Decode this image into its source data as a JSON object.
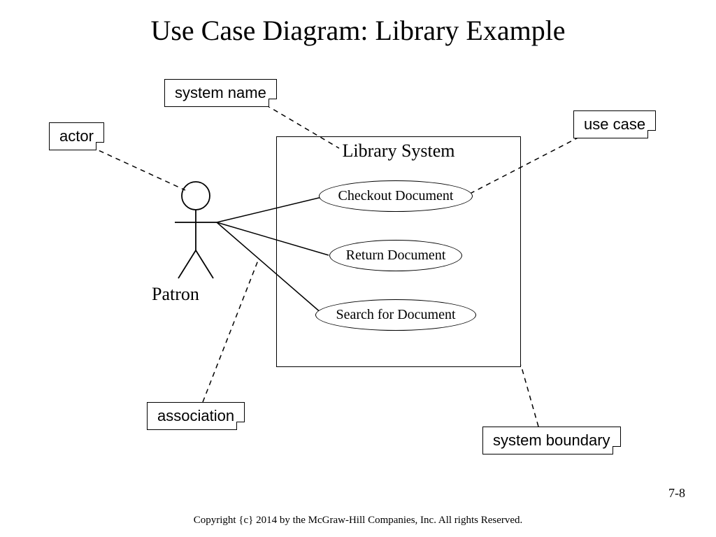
{
  "title": "Use Case Diagram: Library Example",
  "notes": {
    "actor": "actor",
    "system_name": "system name",
    "use_case": "use case",
    "association": "association",
    "system_boundary": "system boundary"
  },
  "system": {
    "title": "Library System",
    "usecases": {
      "checkout": "Checkout Document",
      "return": "Return Document",
      "search": "Search for Document"
    }
  },
  "actor": {
    "name": "Patron"
  },
  "footer": "Copyright {c} 2014 by the McGraw-Hill Companies, Inc. All rights Reserved.",
  "page_number": "7-8"
}
